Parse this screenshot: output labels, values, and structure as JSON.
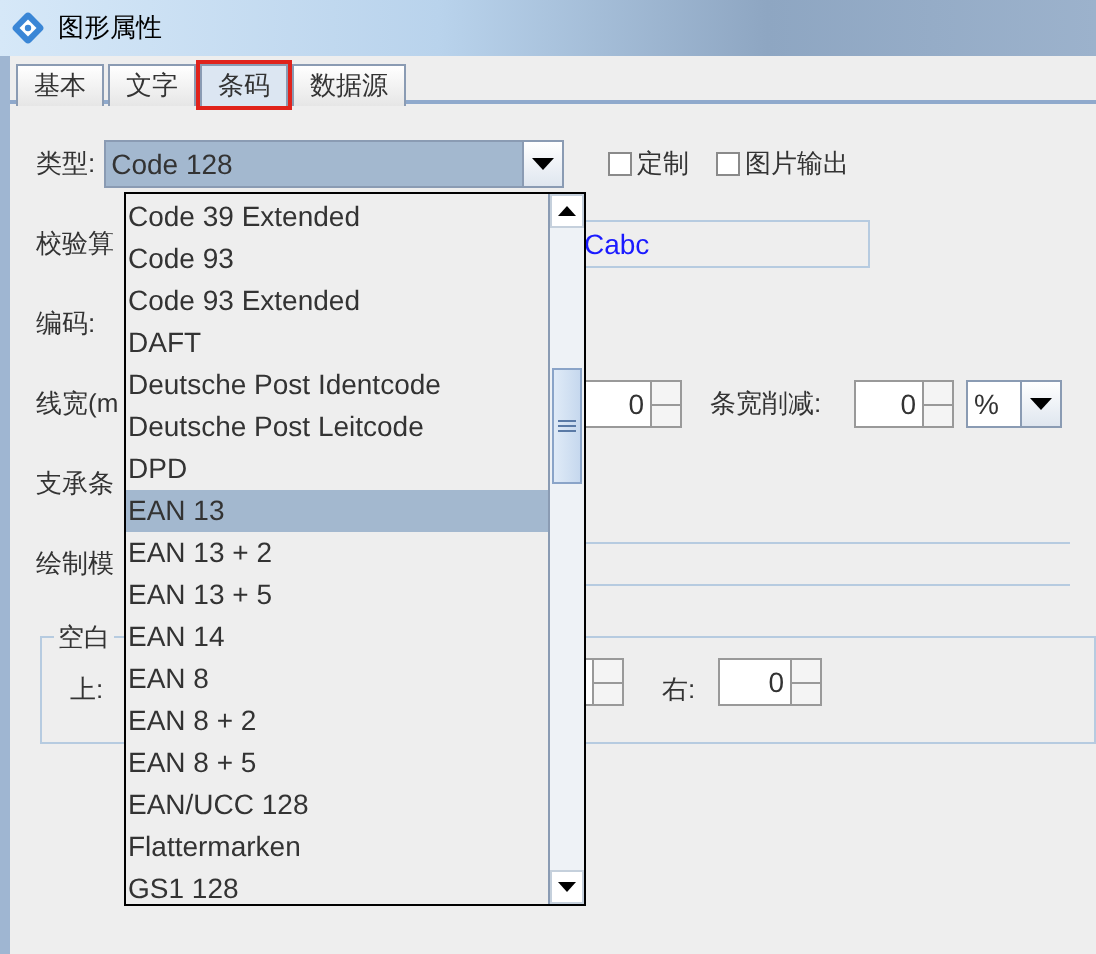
{
  "window": {
    "title": "图形属性"
  },
  "tabs": [
    {
      "label": "基本",
      "selected": false
    },
    {
      "label": "文字",
      "selected": false
    },
    {
      "label": "条码",
      "selected": true
    },
    {
      "label": "数据源",
      "selected": false
    }
  ],
  "form": {
    "type_label": "类型:",
    "type_value": "Code 128",
    "checkboxes": [
      {
        "label": "定制",
        "checked": false
      },
      {
        "label": "图片输出",
        "checked": false
      }
    ],
    "check_label": "校验算",
    "check_value": "Cabc",
    "encoding_label": "编码:",
    "line_width_label": "线宽(m",
    "line_width_value": "0",
    "bar_reduce_label": "条宽削减:",
    "bar_reduce_value": "0",
    "bar_reduce_unit": "%",
    "support_label": "支承条",
    "draw_label": "绘制模",
    "blank_group": {
      "title": "空白",
      "top_label": "上:",
      "right_label": "右:",
      "right_value": "0"
    }
  },
  "type_list": [
    {
      "label": "Code 39 Extended",
      "selected": false
    },
    {
      "label": "Code 93",
      "selected": false
    },
    {
      "label": "Code 93 Extended",
      "selected": false
    },
    {
      "label": "DAFT",
      "selected": false
    },
    {
      "label": "Deutsche Post Identcode",
      "selected": false
    },
    {
      "label": "Deutsche Post Leitcode",
      "selected": false
    },
    {
      "label": "DPD",
      "selected": false
    },
    {
      "label": "EAN 13",
      "selected": true
    },
    {
      "label": "EAN 13 + 2",
      "selected": false
    },
    {
      "label": "EAN 13 + 5",
      "selected": false
    },
    {
      "label": "EAN 14",
      "selected": false
    },
    {
      "label": "EAN 8",
      "selected": false
    },
    {
      "label": "EAN 8 + 2",
      "selected": false
    },
    {
      "label": "EAN 8 + 5",
      "selected": false
    },
    {
      "label": "EAN/UCC 128",
      "selected": false
    },
    {
      "label": "Flattermarken",
      "selected": false
    },
    {
      "label": "GS1 128",
      "selected": false
    }
  ]
}
